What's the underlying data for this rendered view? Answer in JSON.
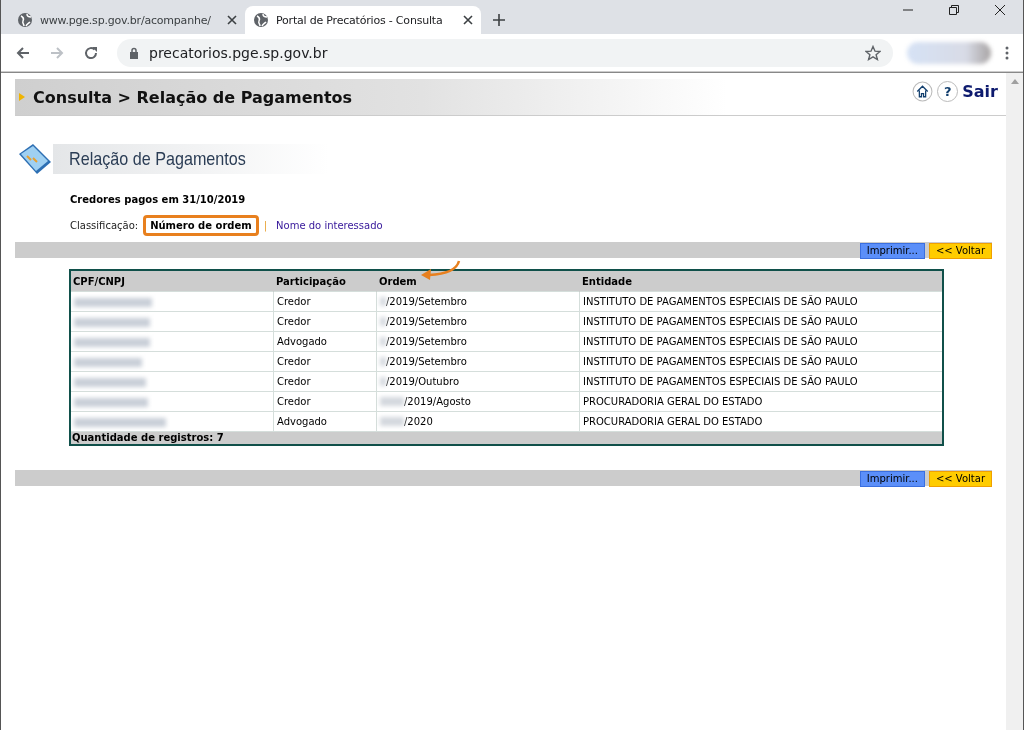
{
  "browser": {
    "tabs": [
      {
        "title": "www.pge.sp.gov.br/acompanhe/",
        "selected": false
      },
      {
        "title": "Portal de Precatórios - Consulta",
        "selected": true
      }
    ],
    "address": "precatorios.pge.sp.gov.br"
  },
  "header": {
    "breadcrumb": "Consulta > Relação de Pagamentos",
    "help": "?",
    "logout": "Sair"
  },
  "section_title": "Relação de Pagamentos",
  "subtitle": "Credores pagos em 31/10/2019",
  "sort": {
    "label": "Classificação:",
    "separator": "|",
    "options": [
      {
        "label": "Número de ordem",
        "selected": true
      },
      {
        "label": "Nome do interessado",
        "selected": false
      }
    ]
  },
  "top_actions": [
    {
      "label": "Imprimir...",
      "kind": "print"
    },
    {
      "label": "<< Voltar",
      "kind": "back"
    }
  ],
  "bottom_actions": [
    {
      "label": "Imprimir...",
      "kind": "print"
    },
    {
      "label": "<< Voltar",
      "kind": "back"
    }
  ],
  "table": {
    "columns": [
      "CPF/CNPJ",
      "Participação",
      "Ordem",
      "Entidade"
    ],
    "rows": [
      {
        "participacao": "Credor",
        "ordem": "/2019/Setembro",
        "entidade": "INSTITUTO DE PAGAMENTOS ESPECIAIS DE SÃO PAULO"
      },
      {
        "participacao": "Credor",
        "ordem": "/2019/Setembro",
        "entidade": "INSTITUTO DE PAGAMENTOS ESPECIAIS DE SÃO PAULO"
      },
      {
        "participacao": "Advogado",
        "ordem": "/2019/Setembro",
        "entidade": "INSTITUTO DE PAGAMENTOS ESPECIAIS DE SÃO PAULO"
      },
      {
        "participacao": "Credor",
        "ordem": "/2019/Setembro",
        "entidade": "INSTITUTO DE PAGAMENTOS ESPECIAIS DE SÃO PAULO"
      },
      {
        "participacao": "Credor",
        "ordem": "/2019/Outubro",
        "entidade": "INSTITUTO DE PAGAMENTOS ESPECIAIS DE SÃO PAULO"
      },
      {
        "participacao": "Credor",
        "ordem": "/2019/Agosto",
        "entidade": "PROCURADORIA GERAL DO ESTADO"
      },
      {
        "participacao": "Advogado",
        "ordem": "/2020",
        "entidade": "PROCURADORIA GERAL DO ESTADO"
      }
    ],
    "footer": "Quantidade de registros: 7"
  }
}
